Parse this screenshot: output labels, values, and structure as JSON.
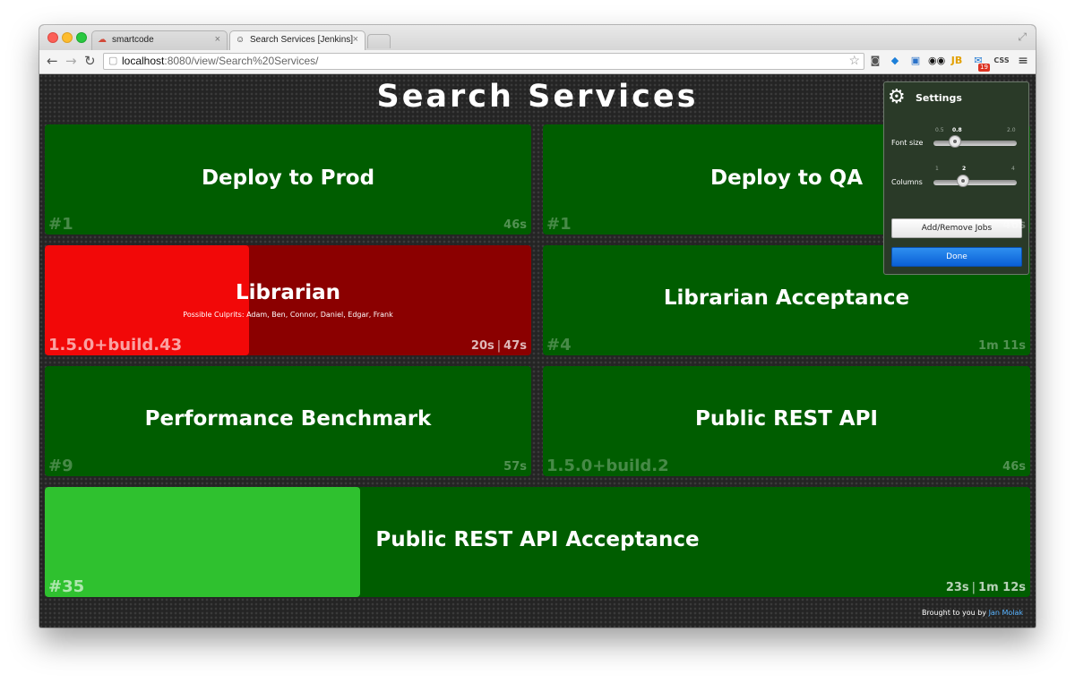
{
  "browser": {
    "tabs": [
      {
        "label": "smartcode",
        "icon": "smartcode-favicon"
      },
      {
        "label": "Search Services [Jenkins]",
        "icon": "jenkins-favicon"
      }
    ],
    "address_host": "localhost",
    "address_path": ":8080/view/Search%20Services/",
    "extension_badge": "19",
    "extension_css_label": "CSS",
    "extension_jb_label": "JB"
  },
  "page": {
    "title": "Search Services",
    "footer_prefix": "Brought to you by",
    "footer_link": "Jan Molak"
  },
  "jobs": [
    {
      "name": "Deploy to Prod",
      "build": "#1",
      "duration": "46s",
      "status": "success"
    },
    {
      "name": "Deploy to QA",
      "build": "#1",
      "duration": "46s",
      "status": "success"
    },
    {
      "name": "Librarian",
      "build": "1.5.0+build.43",
      "duration_elapsed": "20s",
      "duration_estimated": "47s",
      "status": "failed-building",
      "progress": 0.42,
      "culprits": "Possible Culprits: Adam,  Ben,  Connor,  Daniel,  Edgar,  Frank"
    },
    {
      "name": "Librarian Acceptance",
      "build": "#4",
      "duration": "1m 11s",
      "status": "success"
    },
    {
      "name": "Performance Benchmark",
      "build": "#9",
      "duration": "57s",
      "status": "success"
    },
    {
      "name": "Public REST API",
      "build": "1.5.0+build.2",
      "duration": "46s",
      "status": "success"
    },
    {
      "name": "Public REST API Acceptance",
      "build": "#35",
      "duration_elapsed": "23s",
      "duration_estimated": "1m 12s",
      "status": "success-building",
      "progress": 0.32
    }
  ],
  "colors": {
    "success": "#005d00",
    "success_progress": "#2fc12f",
    "failed": "#8b0000",
    "failed_progress": "#f20808"
  },
  "settings": {
    "title": "Settings",
    "font_size_label": "Font size",
    "font_size_ticks": [
      "0.5",
      "0.8",
      "2.0"
    ],
    "font_size_value": 0.8,
    "columns_label": "Columns",
    "columns_ticks": [
      "1",
      "2",
      "4"
    ],
    "columns_value": 2,
    "add_remove_label": "Add/Remove Jobs",
    "done_label": "Done"
  }
}
